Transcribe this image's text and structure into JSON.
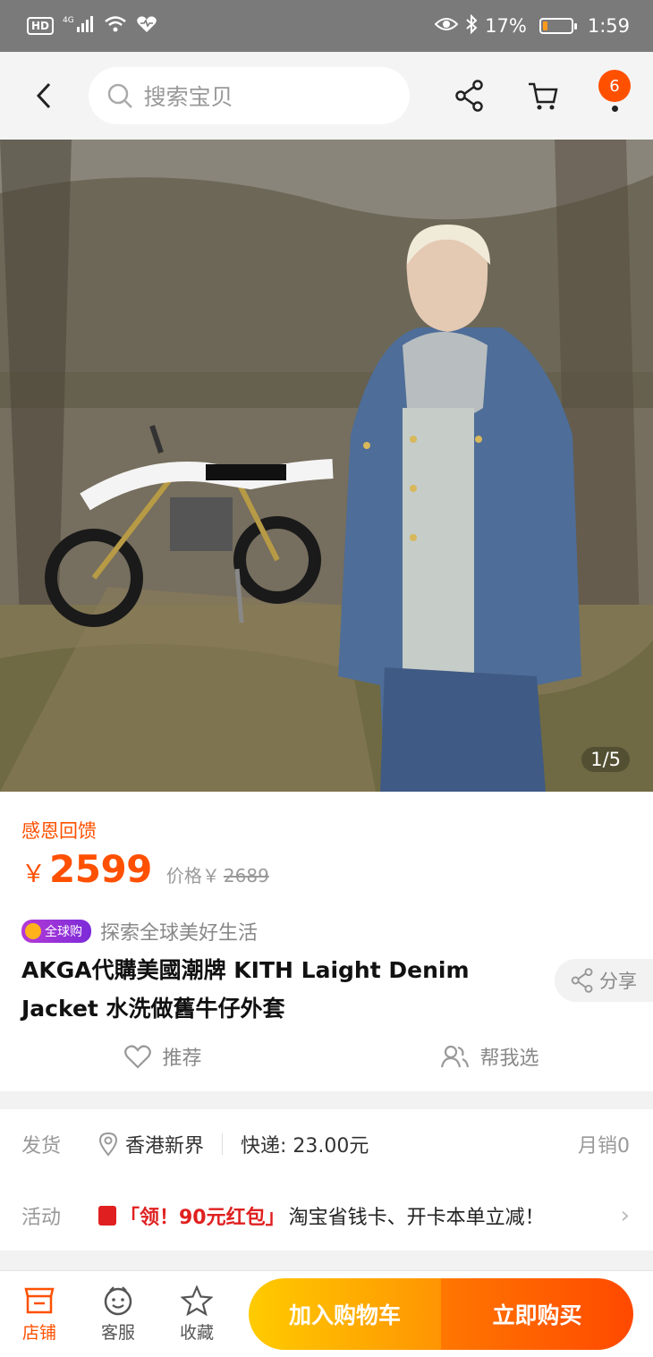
{
  "status_bar": {
    "left_badge": "HD",
    "network": "4G",
    "battery_text": "17%",
    "battery_level": 0.17,
    "time": "1:59",
    "battery_color": "#ff9a1a"
  },
  "top_nav": {
    "search_placeholder": "搜索宝贝",
    "cart_count": "6"
  },
  "hero": {
    "page_indicator": "1/5"
  },
  "product": {
    "promo_title": "感恩回馈",
    "currency_symbol": "￥",
    "price": "2599",
    "orig_label": "价格￥",
    "orig_price": "2689",
    "global_tag": "全球购",
    "global_text": "探索全球美好生活",
    "title": "AKGA代購美國潮牌 KITH Laight Denim Jacket 水洗做舊牛仔外套",
    "share_label": "分享",
    "recommend_label": "推荐",
    "help_choose_label": "帮我选"
  },
  "shipping": {
    "label": "发货",
    "location": "香港新界",
    "fee": "快递: 23.00元",
    "monthly_sales": "月销0"
  },
  "activity": {
    "label": "活动",
    "tag": "「领！90元红包」",
    "description": "淘宝省钱卡、开卡本单立减！"
  },
  "bottom_bar": {
    "store_label": "店铺",
    "service_label": "客服",
    "favorite_label": "收藏",
    "add_cart_label": "加入购物车",
    "buy_now_label": "立即购买"
  },
  "colors": {
    "accent": "#ff5000",
    "cart_button": "#ffa402",
    "buy_button": "#ff5a00"
  }
}
